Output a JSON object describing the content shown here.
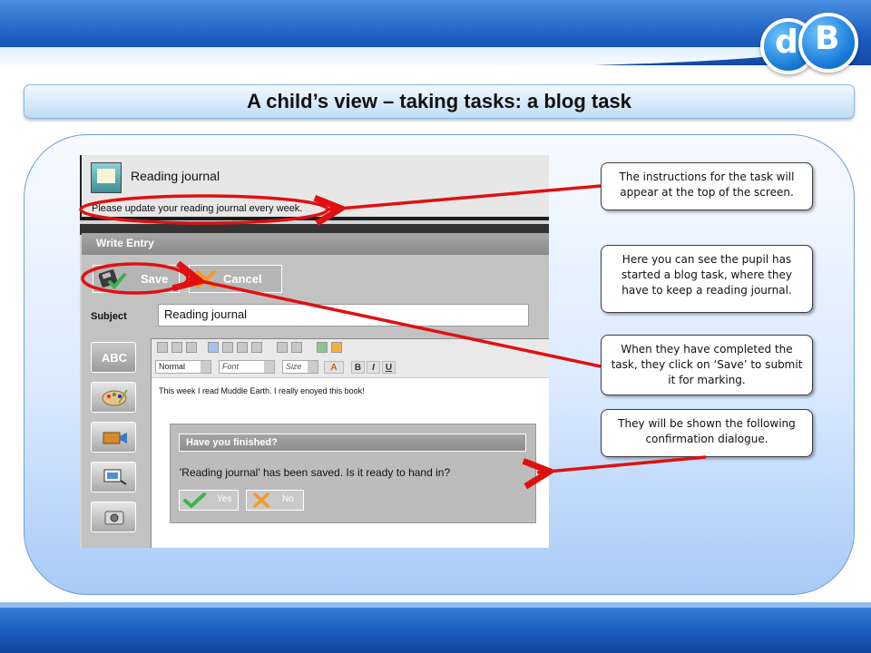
{
  "slide": {
    "title": "A child’s view – taking tasks: a blog task",
    "logo_text_d": "d",
    "logo_text_b": "B"
  },
  "app": {
    "header_title": "Reading journal",
    "instructions": "Please update your reading journal every week.",
    "write_entry_label": "Write Entry",
    "save_label": "Save",
    "cancel_label": "Cancel",
    "subject_label": "Subject",
    "subject_value": "Reading journal",
    "tabs": [
      {
        "label": "ABC"
      },
      {
        "label": ""
      }
    ],
    "editor": {
      "format_select": "Normal",
      "font_select": "Font",
      "size_select": "Size",
      "bold": "B",
      "italic": "I",
      "underline": "U",
      "body_text": "This week I read Muddle Earth. I really enoyed this book!"
    },
    "dialog": {
      "title": "Have you finished?",
      "message": "'Reading journal' has been saved. Is it ready to hand in?",
      "yes_label": "Yes",
      "no_label": "No"
    }
  },
  "callouts": [
    "The instructions for the task will appear at the top of the screen.",
    "Here you can see the pupil has started a blog task, where they have to keep a reading journal.",
    "When they have completed the task, they click on ‘Save’ to submit it for marking.",
    "They will be shown the following confirmation dialogue."
  ],
  "colors": {
    "annotation_red": "#e01010",
    "slide_blue": "#1e5fc0"
  }
}
